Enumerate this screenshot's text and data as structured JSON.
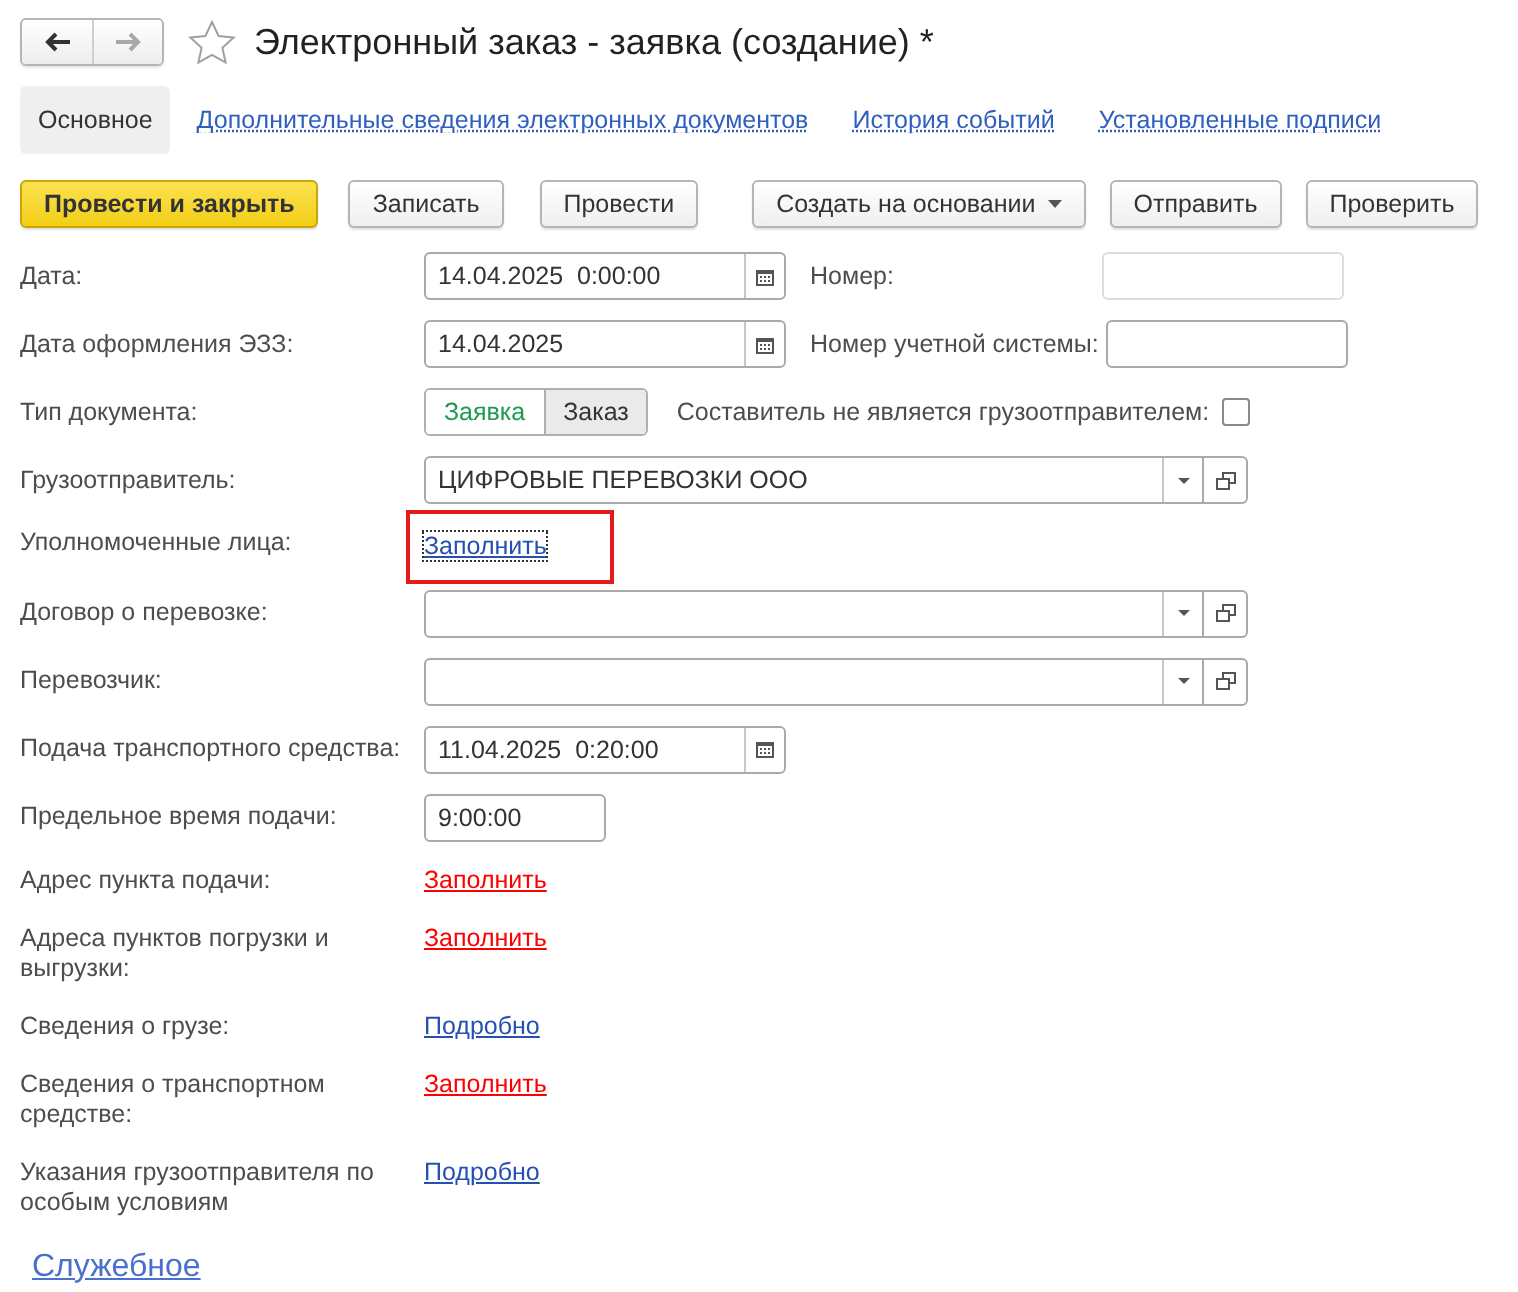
{
  "window": {
    "title": "Электронный заказ - заявка (создание) *",
    "starred": false
  },
  "nav_buttons": [
    {
      "kind": "back",
      "disabled": false
    },
    {
      "kind": "forward",
      "disabled": true
    }
  ],
  "tabs": [
    {
      "label": "Основное",
      "selected": true
    },
    {
      "label": "Дополнительные сведения электронных документов",
      "selected": false
    },
    {
      "label": "История событий",
      "selected": false
    },
    {
      "label": "Установленные подписи",
      "selected": false
    }
  ],
  "toolbar": [
    {
      "label": "Провести и закрыть",
      "kind": "default"
    },
    {
      "label": "Записать",
      "kind": "plain"
    },
    {
      "label": "Провести",
      "kind": "plain"
    },
    {
      "label": "Создать на основании",
      "kind": "menu"
    },
    {
      "label": "Отправить",
      "kind": "plain"
    },
    {
      "label": "Проверить",
      "kind": "plain"
    }
  ],
  "fields": [
    {
      "kind": "date",
      "label": "Дата:",
      "value": "14.04.2025  0:00:00",
      "side": {
        "kind": "text",
        "label": "Номер:",
        "disabled": true
      }
    },
    {
      "kind": "date",
      "label": "Дата оформления ЭЗЗ:",
      "value": "14.04.2025",
      "side": {
        "kind": "text",
        "label": "Номер учетной системы:",
        "disabled": false
      }
    },
    {
      "kind": "toggle",
      "label": "Тип документа:",
      "options": [
        {
          "label": "Заявка",
          "selected": true
        },
        {
          "label": "Заказ",
          "selected": false
        }
      ],
      "side": {
        "kind": "checkbox",
        "label": "Составитель не является грузоотправителем:",
        "checked": false
      }
    },
    {
      "kind": "select",
      "label": "Грузоотправитель:",
      "value": "ЦИФРОВЫЕ ПЕРЕВОЗКИ ООО"
    },
    {
      "kind": "link",
      "label": "Уполномоченные лица:",
      "link": "Заполнить",
      "required": false,
      "highlighted": true
    },
    {
      "kind": "select",
      "label": "Договор о перевозке:"
    },
    {
      "kind": "select",
      "label": "Перевозчик:"
    },
    {
      "kind": "date",
      "label": "Подача транспортного средства:",
      "value": "11.04.2025  0:20:00"
    },
    {
      "kind": "time",
      "label": "Предельное время подачи:",
      "value": "9:00:00"
    },
    {
      "kind": "link",
      "label": "Адрес пункта подачи:",
      "link": "Заполнить",
      "required": true,
      "highlighted": false
    },
    {
      "kind": "link",
      "label": "Адреса пунктов погрузки и выгрузки:",
      "link": "Заполнить",
      "required": true,
      "highlighted": false
    },
    {
      "kind": "link",
      "label": "Сведения о грузе:",
      "link": "Подробно",
      "required": false,
      "highlighted": false
    },
    {
      "kind": "link",
      "label": "Сведения о транспортном средстве:",
      "link": "Заполнить",
      "required": true,
      "highlighted": false
    },
    {
      "kind": "link",
      "label": "Указания грузоотправителя по особым условиям",
      "link": "Подробно",
      "required": false,
      "highlighted": false
    }
  ],
  "footer_link": "Служебное"
}
